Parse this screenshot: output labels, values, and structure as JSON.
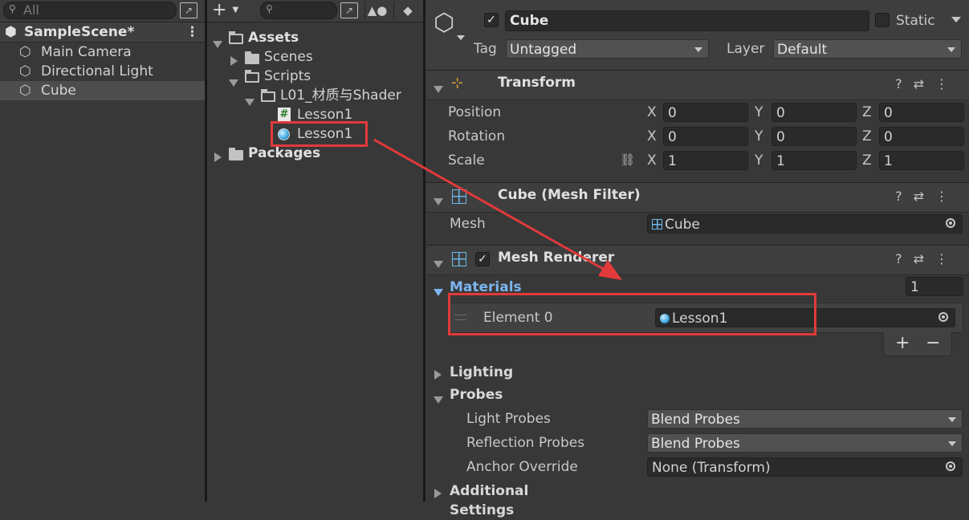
{
  "hierarchy": {
    "search_placeholder": "All",
    "scene": "SampleScene*",
    "items": [
      "Main Camera",
      "Directional Light",
      "Cube"
    ]
  },
  "project": {
    "add_label": "+",
    "tree": {
      "assets": "Assets",
      "scenes": "Scenes",
      "scripts": "Scripts",
      "folder": "L01_材质与Shader",
      "script_file": "Lesson1",
      "material_file": "Lesson1",
      "packages": "Packages"
    }
  },
  "inspector": {
    "object_name": "Cube",
    "active": true,
    "static_label": "Static",
    "tag_label": "Tag",
    "tag_value": "Untagged",
    "layer_label": "Layer",
    "layer_value": "Default",
    "transform": {
      "title": "Transform",
      "rows": [
        {
          "label": "Position",
          "x": "0",
          "y": "0",
          "z": "0"
        },
        {
          "label": "Rotation",
          "x": "0",
          "y": "0",
          "z": "0"
        },
        {
          "label": "Scale",
          "x": "1",
          "y": "1",
          "z": "1"
        }
      ],
      "axis_x": "X",
      "axis_y": "Y",
      "axis_z": "Z"
    },
    "mesh_filter": {
      "title": "Cube (Mesh Filter)",
      "mesh_label": "Mesh",
      "mesh_value": "Cube"
    },
    "mesh_renderer": {
      "title": "Mesh Renderer",
      "enabled": true,
      "materials_label": "Materials",
      "materials_count": "1",
      "element_label": "Element 0",
      "element_value": "Lesson1",
      "add": "+",
      "remove": "−",
      "lighting_label": "Lighting",
      "probes_label": "Probes",
      "light_probes_label": "Light Probes",
      "light_probes_value": "Blend Probes",
      "reflection_probes_label": "Reflection Probes",
      "reflection_probes_value": "Blend Probes",
      "anchor_label": "Anchor Override",
      "anchor_value": "None (Transform)",
      "additional_label": "Additional Settings"
    }
  },
  "colors": {
    "accent_blue": "#7cb5f0",
    "highlight_red": "#e23a3a",
    "selection": "#4d4d4d"
  }
}
